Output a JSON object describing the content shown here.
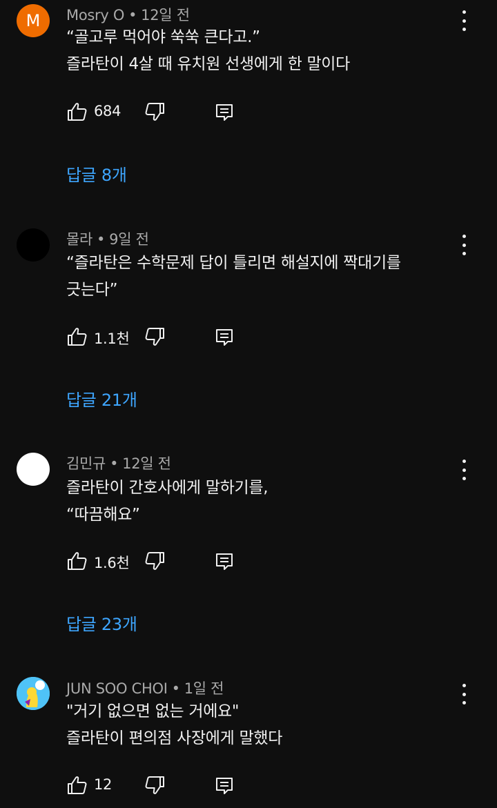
{
  "comments": [
    {
      "author": "Mosry O",
      "time": "12일 전",
      "avatar_letter": "M",
      "avatar_color": "#ef6c00",
      "lines": [
        "“골고루 먹어야 쑥쑥 큰다고.”",
        "즐라탄이 4살 때 유치원 선생에게 한 말이다"
      ],
      "likes": "684",
      "replies": "답글 8개"
    },
    {
      "author": "몰라",
      "time": "9일 전",
      "avatar_letter": "",
      "avatar_color": "#000000",
      "lines": [
        "“즐라탄은 수학문제 답이 틀리면 해설지에 짝대기를",
        "긋는다”"
      ],
      "likes": "1.1천",
      "replies": "답글 21개"
    },
    {
      "author": "김민규",
      "time": "12일 전",
      "avatar_letter": "",
      "avatar_color": "#ffffff",
      "lines": [
        "즐라탄이 간호사에게 말하기를,",
        "“따끔해요”"
      ],
      "likes": "1.6천",
      "replies": "답글 23개"
    },
    {
      "author": "JUN SOO CHOI",
      "time": "1일 전",
      "avatar_letter": "",
      "avatar_color": "#4fc3f7",
      "lines": [
        "\"거기 없으면 없는 거에요\"",
        "즐라탄이 편의점 사장에게 말했다"
      ],
      "likes": "12",
      "replies": ""
    }
  ],
  "separator": "•",
  "icons": {
    "like": "thumb-up-icon",
    "dislike": "thumb-down-icon",
    "reply": "reply-comment-icon",
    "more": "more-vertical-icon"
  },
  "colors": {
    "background": "#0f0f0f",
    "text": "#f1f1f1",
    "meta": "#aaaaaa",
    "link": "#3ea6ff"
  }
}
